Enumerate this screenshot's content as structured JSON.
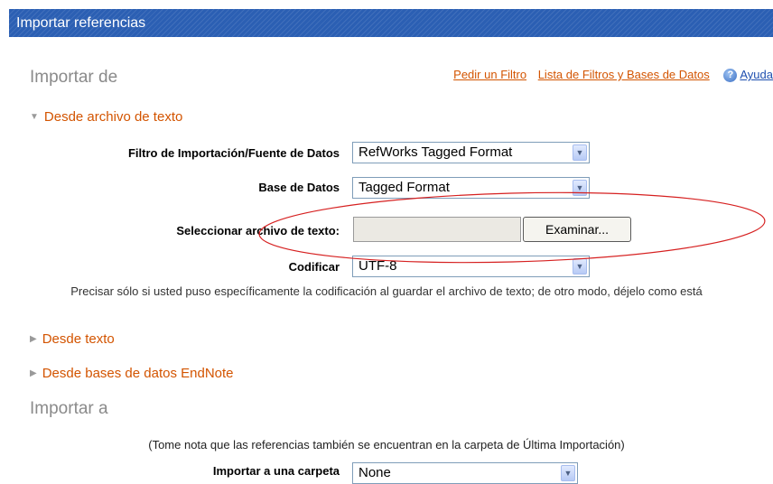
{
  "window": {
    "title": "Importar referencias"
  },
  "import_from": {
    "heading": "Importar de",
    "links": [
      "Pedir un Filtro",
      "Lista de Filtros y Bases de Datos"
    ],
    "help_icon": "help-icon",
    "help_label": "Ayuda",
    "file_section": {
      "toggle_label": "Desde archivo de texto",
      "expanded": true,
      "filter": {
        "label": "Filtro de Importación/Fuente de Datos",
        "value": "RefWorks Tagged Format"
      },
      "database": {
        "label": "Base de Datos",
        "value": "Tagged Format"
      },
      "file": {
        "label": "Seleccionar archivo de texto:",
        "value": "",
        "button_label": "Examinar..."
      },
      "encoding": {
        "label": "Codificar",
        "value": "UTF-8"
      },
      "help_text": "Precisar sólo si usted puso específicamente la codificación al guardar el archivo de texto; de otro modo, déjelo como está"
    },
    "collapsed_sections": [
      "Desde texto",
      "Desde bases de datos EndNote"
    ]
  },
  "import_to": {
    "heading": "Importar a",
    "note": "(Tome nota que las referencias también se encuentran en la carpeta de Última Importación)",
    "folder": {
      "label": "Importar a una carpeta",
      "value": "None"
    }
  },
  "colors": {
    "title_bar": "#2b5fb3",
    "link": "#d35400",
    "section_heading": "#8a8a8a",
    "annotation": "#d62020"
  }
}
